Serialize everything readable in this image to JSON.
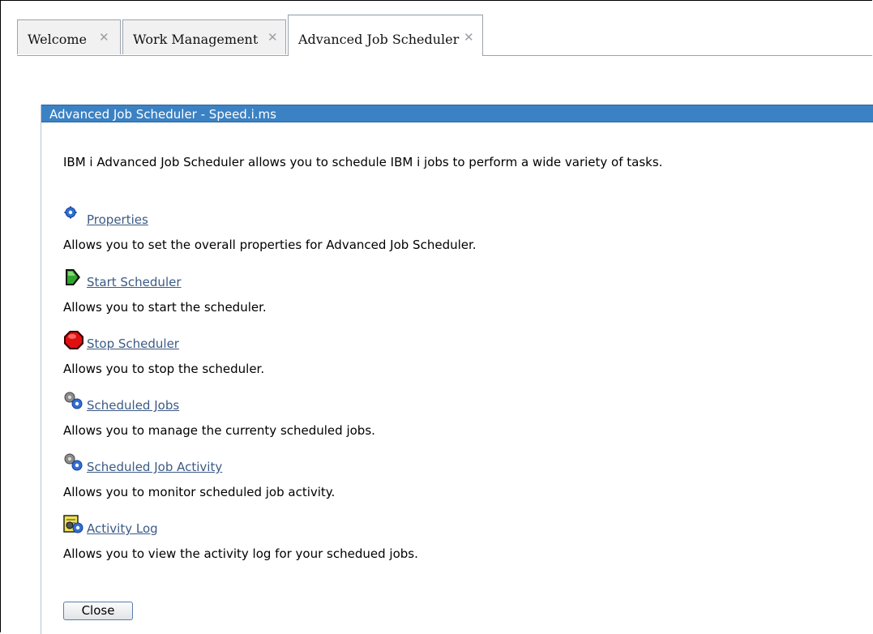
{
  "tabs": [
    {
      "label": "Welcome",
      "close_icon": "✕"
    },
    {
      "label": "Work Management",
      "close_icon": "✕"
    },
    {
      "label": "Advanced Job Scheduler",
      "close_icon": "✕"
    }
  ],
  "panel": {
    "title": "Advanced Job Scheduler - Speed.i.ms",
    "intro": "IBM i Advanced Job Scheduler allows you to schedule IBM i jobs to perform a wide variety of tasks.",
    "items": [
      {
        "icon": "gear-icon",
        "label": "Properties",
        "description": "Allows you to set the overall properties for Advanced Job Scheduler."
      },
      {
        "icon": "start-arrow-icon",
        "label": "Start Scheduler",
        "description": "Allows you to start the scheduler."
      },
      {
        "icon": "stop-sign-icon",
        "label": "Stop Scheduler",
        "description": "Allows you to stop the scheduler."
      },
      {
        "icon": "gears-icon",
        "label": "Scheduled Jobs",
        "description": "Allows you to manage the currenty scheduled jobs."
      },
      {
        "icon": "gears-icon",
        "label": "Scheduled Job Activity",
        "description": "Allows you to monitor scheduled job activity."
      },
      {
        "icon": "activity-log-icon",
        "label": "Activity Log",
        "description": "Allows you to view the activity log for your schedued jobs."
      }
    ],
    "close_label": "Close"
  },
  "colors": {
    "header_bg": "#3b82c4",
    "link": "#3c5a85"
  }
}
